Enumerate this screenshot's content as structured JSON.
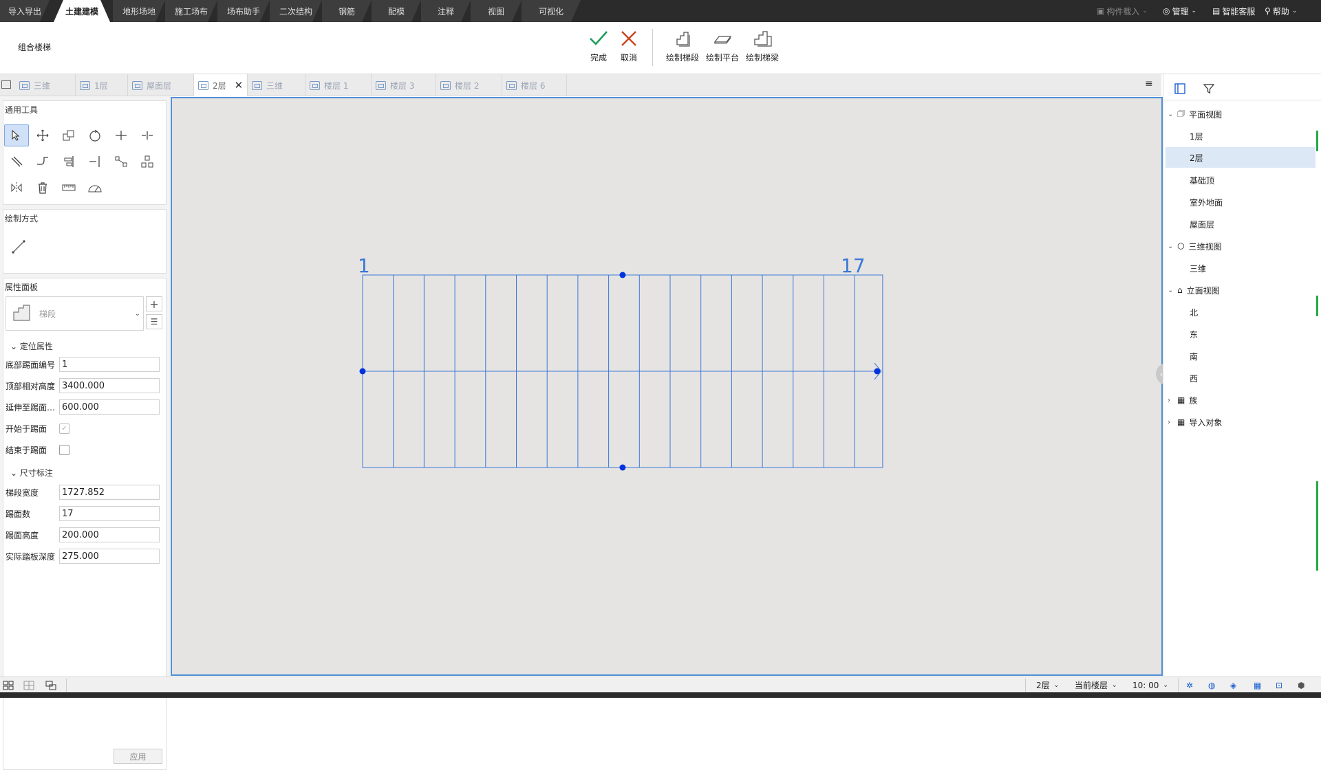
{
  "menubar": {
    "tabs": [
      "导入导出",
      "土建建模",
      "地形场地",
      "施工场布",
      "场布助手",
      "二次结构",
      "钢筋",
      "配模",
      "注释",
      "视图",
      "可视化"
    ],
    "active_index": 1,
    "right": {
      "component_load": "构件载入",
      "manage": "管理",
      "smart_service": "智能客服",
      "help": "帮助"
    }
  },
  "ribbon": {
    "title": "组合楼梯",
    "finish": "完成",
    "cancel": "取消",
    "draw_flight": "绘制梯段",
    "draw_platform": "绘制平台",
    "draw_beam": "绘制梯梁"
  },
  "doc_tabs": [
    "三维",
    "1层",
    "屋面层",
    "2层",
    "三维",
    "楼层 1",
    "楼层 3",
    "楼层 2",
    "楼层 6"
  ],
  "doc_tab_active": 3,
  "left": {
    "tools_title": "通用工具",
    "draw_mode_title": "绘制方式",
    "props_title": "属性面板",
    "type_name": "梯段",
    "section_position": "定位属性",
    "section_dimension": "尺寸标注",
    "props": {
      "bottom_tread_no": {
        "label": "底部踢面编号",
        "value": "1"
      },
      "top_rel_height": {
        "label": "顶部相对高度",
        "value": "3400.000"
      },
      "extend_to_tread": {
        "label": "延伸至踢面…",
        "value": "600.000"
      },
      "start_at_riser": {
        "label": "开始于踢面",
        "checked": true
      },
      "end_at_riser": {
        "label": "结束于踢面",
        "checked": false
      },
      "flight_width": {
        "label": "梯段宽度",
        "value": "1727.852"
      },
      "riser_count": {
        "label": "踢面数",
        "value": "17"
      },
      "riser_height": {
        "label": "踢面高度",
        "value": "200.000"
      },
      "tread_depth": {
        "label": "实际踏板深度",
        "value": "275.000"
      }
    },
    "apply": "应用"
  },
  "canvas": {
    "start_label": "1",
    "end_label": "17",
    "riser_count": 17
  },
  "tree": {
    "plan": {
      "label": "平面视图",
      "items": [
        "1层",
        "2层",
        "基础顶",
        "室外地面",
        "屋面层"
      ],
      "selected": 1
    },
    "three_d": {
      "label": "三维视图",
      "items": [
        "三维"
      ]
    },
    "elevation": {
      "label": "立面视图",
      "items": [
        "北",
        "东",
        "南",
        "西"
      ]
    },
    "family": "族",
    "imported": "导入对象"
  },
  "status": {
    "floor": "2层",
    "scope": "当前楼层",
    "scale": "10: 00"
  },
  "colors": {
    "accent": "#1c5fd1",
    "select_blue": "#0033dd",
    "dark": "#2b2b2b"
  }
}
